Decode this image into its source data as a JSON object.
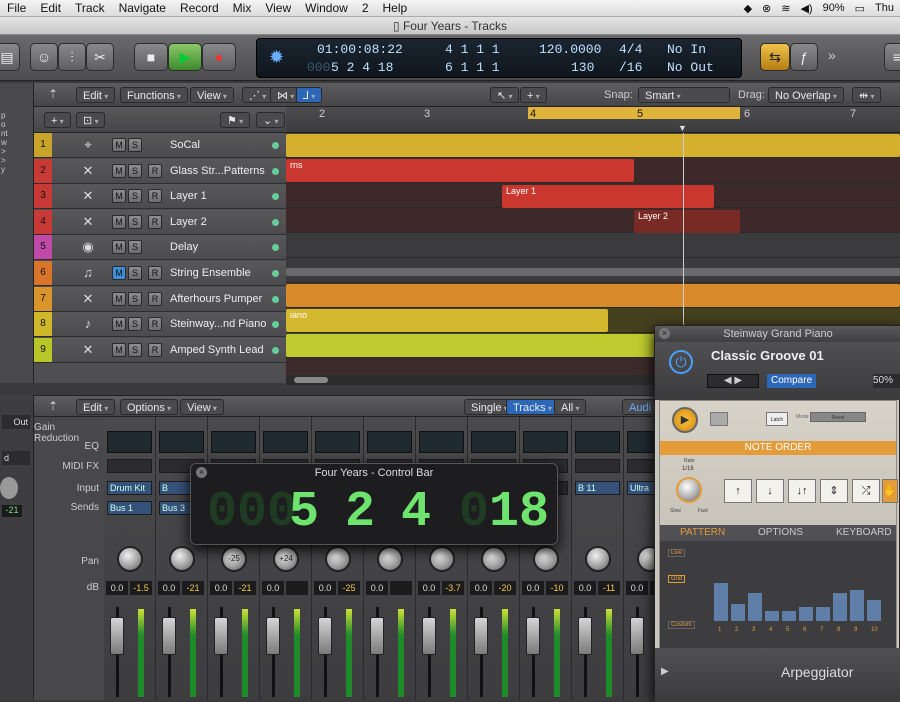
{
  "menubar": {
    "items": [
      "File",
      "Edit",
      "Track",
      "Navigate",
      "Record",
      "Mix",
      "View",
      "Window",
      "2",
      "Help"
    ],
    "battery": "90%",
    "day": "Thu"
  },
  "window": {
    "title": "Four Years - Tracks"
  },
  "lcd": {
    "time": "01:00:08:22",
    "bars_top": "4 1 1 1",
    "bars_bottom": "5 2 4 18",
    "bars_bottom_prefix": "000",
    "bars_top_prefix": "000",
    "pos_top": "4 1 1 1",
    "pos_bottom": "6 1 1 1",
    "tempo": "120.0000",
    "tempo2": "130",
    "sig": "4/4",
    "div": "/16",
    "in": "No In",
    "out": "No Out"
  },
  "track_toolbar": {
    "edit": "Edit",
    "functions": "Functions",
    "view": "View",
    "snap_label": "Snap:",
    "snap": "Smart",
    "drag_label": "Drag:",
    "drag": "No Overlap"
  },
  "ruler": {
    "marks": [
      "2",
      "3",
      "4",
      "5",
      "6",
      "7"
    ]
  },
  "left_strip": {
    "lines": [
      "p",
      "o",
      "nt",
      "w",
      ">",
      ">",
      "y"
    ]
  },
  "tracks": [
    {
      "num": "1",
      "name": "SoCal",
      "color": "#c9a42a",
      "r": false,
      "icon": "drum-icon"
    },
    {
      "num": "2",
      "name": "Glass Str...Patterns",
      "color": "#c73a35",
      "r": true,
      "icon": "synth-icon"
    },
    {
      "num": "3",
      "name": "Layer 1",
      "color": "#c73a35",
      "r": true,
      "icon": "synth-icon"
    },
    {
      "num": "4",
      "name": "Layer 2",
      "color": "#c73a35",
      "r": true,
      "icon": "synth-icon"
    },
    {
      "num": "5",
      "name": "Delay",
      "color": "#c04aa8",
      "r": false,
      "icon": "delay-icon"
    },
    {
      "num": "6",
      "name": "String Ensemble",
      "color": "#d9752a",
      "r": true,
      "icon": "strings-icon"
    },
    {
      "num": "7",
      "name": "Afterhours Pumper",
      "color": "#d9952a",
      "r": true,
      "icon": "synth-icon"
    },
    {
      "num": "8",
      "name": "Steinway...nd Piano",
      "color": "#d0b72a",
      "r": true,
      "icon": "piano-icon"
    },
    {
      "num": "9",
      "name": "Amped Synth Lead",
      "color": "#b8c62a",
      "r": true,
      "icon": "synth-icon"
    }
  ],
  "regions": {
    "r2": "rns",
    "r3": "Layer 1",
    "r4": "Layer 2",
    "r8": "iano"
  },
  "mixer_toolbar": {
    "edit": "Edit",
    "options": "Options",
    "view": "View",
    "single": "Single",
    "tracks": "Tracks",
    "all": "All",
    "audio": "Audi"
  },
  "mixer_labels": {
    "gain": "Gain Reduction",
    "eq": "EQ",
    "midifx": "MIDI FX",
    "input": "Input",
    "sends": "Sends",
    "pan": "Pan",
    "db": "dB"
  },
  "mixer": {
    "inputs": [
      "Drum Kit",
      "B",
      "",
      "",
      "",
      "",
      "",
      "",
      "",
      "B 11",
      "Ultra"
    ],
    "sends": [
      "Bus 1",
      "Bus 3"
    ],
    "pans": [
      "",
      "",
      "-25",
      "+24",
      "",
      "",
      "",
      "",
      "",
      "",
      ""
    ],
    "db1": [
      "0.0",
      "0.0",
      "0.0",
      "0.0",
      "0.0",
      "0.0",
      "0.0",
      "0.0",
      "0.0",
      "0.0",
      "0.0"
    ],
    "db2": [
      "-1.5",
      "-21",
      "-21",
      "",
      "-25",
      "",
      "-3.7",
      "-20",
      "-10",
      "-11",
      ""
    ],
    "side_vals": [
      "Out",
      "d",
      "-21"
    ]
  },
  "controlbar_popup": {
    "title": "Four Years - Control Bar",
    "bar": "5",
    "beat": "2",
    "div": "4",
    "tick": "18",
    "dim_prefix": "000",
    "tick_prefix": "0"
  },
  "plugin": {
    "title": "Steinway Grand Piano",
    "preset": "Classic Groove 01",
    "compare": "Compare",
    "zoom": "50%",
    "latch": "Latch",
    "mode": "Mode",
    "reset": "Reset",
    "note_order": "NOTE ORDER",
    "rate_label": "Rate",
    "rate": "1/16",
    "slow": "Slow",
    "fast": "Fast",
    "tabs": [
      "PATTERN",
      "OPTIONS",
      "KEYBOARD"
    ],
    "live": "Live",
    "grid": "Grid",
    "custom": "Custom",
    "steps": [
      "1",
      "2",
      "3",
      "4",
      "5",
      "6",
      "7",
      "8",
      "9",
      "10"
    ],
    "name": "Arpeggiator",
    "step_values": [
      0.55,
      0.25,
      0.4,
      0.15,
      0.15,
      0.2,
      0.2,
      0.4,
      0.45,
      0.3
    ]
  }
}
